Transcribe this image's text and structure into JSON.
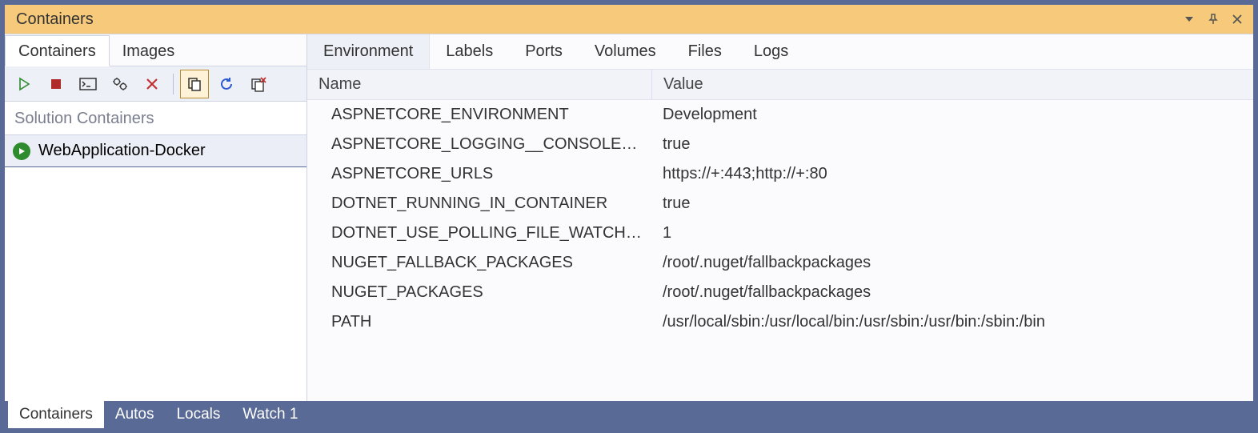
{
  "window": {
    "title": "Containers"
  },
  "left": {
    "tabs": [
      {
        "label": "Containers",
        "active": true
      },
      {
        "label": "Images",
        "active": false
      }
    ],
    "section_label": "Solution Containers",
    "items": [
      {
        "label": "WebApplication-Docker",
        "active": true
      }
    ]
  },
  "toolbar": {
    "buttons": [
      {
        "name": "start-button"
      },
      {
        "name": "stop-button"
      },
      {
        "name": "terminal-button"
      },
      {
        "name": "settings-button"
      },
      {
        "name": "delete-button"
      }
    ],
    "buttons2": [
      {
        "name": "copy-button",
        "active": true
      },
      {
        "name": "refresh-button"
      },
      {
        "name": "prune-button"
      }
    ]
  },
  "detail": {
    "tabs": [
      {
        "label": "Environment",
        "active": true
      },
      {
        "label": "Labels"
      },
      {
        "label": "Ports"
      },
      {
        "label": "Volumes"
      },
      {
        "label": "Files"
      },
      {
        "label": "Logs"
      }
    ],
    "columns": {
      "name": "Name",
      "value": "Value"
    },
    "rows": [
      {
        "name": "ASPNETCORE_ENVIRONMENT",
        "value": "Development"
      },
      {
        "name": "ASPNETCORE_LOGGING__CONSOLE__DISABLECOLORS",
        "value": "true"
      },
      {
        "name": "ASPNETCORE_URLS",
        "value": "https://+:443;http://+:80"
      },
      {
        "name": "DOTNET_RUNNING_IN_CONTAINER",
        "value": "true"
      },
      {
        "name": "DOTNET_USE_POLLING_FILE_WATCHER",
        "value": "1"
      },
      {
        "name": "NUGET_FALLBACK_PACKAGES",
        "value": "/root/.nuget/fallbackpackages"
      },
      {
        "name": "NUGET_PACKAGES",
        "value": "/root/.nuget/fallbackpackages"
      },
      {
        "name": "PATH",
        "value": "/usr/local/sbin:/usr/local/bin:/usr/sbin:/usr/bin:/sbin:/bin"
      }
    ]
  },
  "bottom_tabs": [
    {
      "label": "Containers",
      "active": true
    },
    {
      "label": "Autos"
    },
    {
      "label": "Locals"
    },
    {
      "label": "Watch 1"
    }
  ]
}
